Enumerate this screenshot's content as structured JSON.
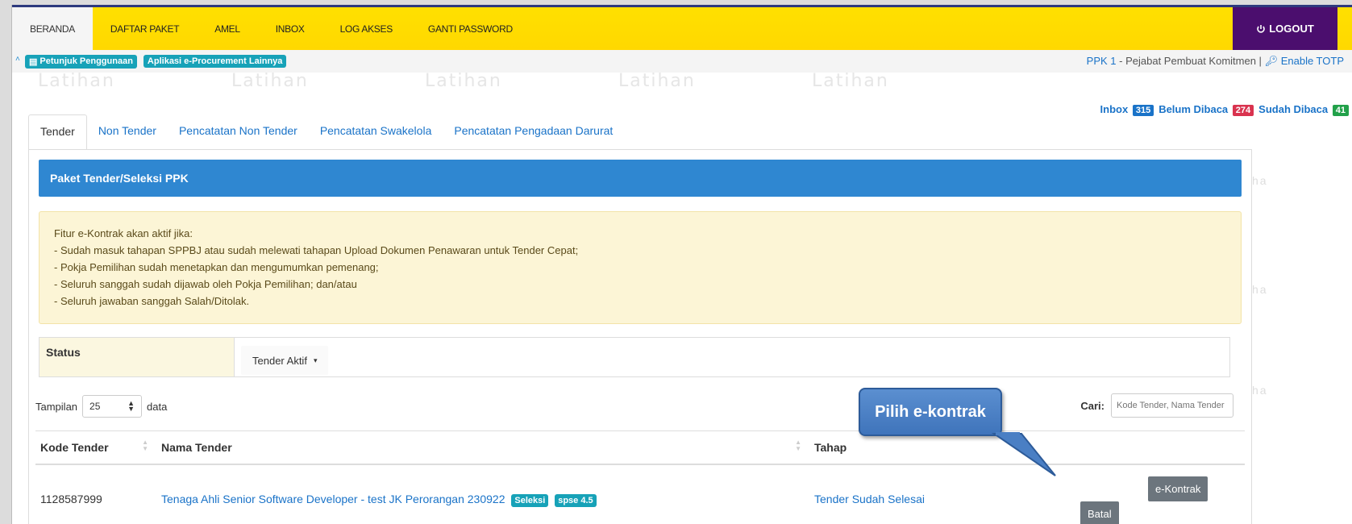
{
  "nav": {
    "items": [
      "BERANDA",
      "DAFTAR PAKET",
      "AMEL",
      "INBOX",
      "LOG AKSES",
      "GANTI PASSWORD"
    ],
    "logout": "LOGOUT"
  },
  "strip": {
    "petunjuk": "Petunjuk Penggunaan",
    "aplikasi": "Aplikasi e-Procurement Lainnya",
    "role": "PPK 1",
    "role_desc": " - Pejabat Pembuat Komitmen | ",
    "enable_totp": "Enable TOTP"
  },
  "inbox": {
    "inbox_label": "Inbox",
    "inbox_count": "315",
    "unread_label": "Belum Dibaca",
    "unread_count": "274",
    "read_label": "Sudah Dibaca",
    "read_count": "41"
  },
  "tabs": [
    "Tender",
    "Non Tender",
    "Pencatatan Non Tender",
    "Pencatatan Swakelola",
    "Pencatatan Pengadaan Darurat"
  ],
  "panel_title": "Paket Tender/Seleksi PPK",
  "notice": [
    "Fitur e-Kontrak akan aktif jika:",
    "- Sudah masuk tahapan SPPBJ atau sudah melewati tahapan Upload Dokumen Penawaran untuk Tender Cepat;",
    "- Pokja Pemilihan sudah menetapkan dan mengumumkan pemenang;",
    "- Seluruh sanggah sudah dijawab oleh Pokja Pemilihan; dan/atau",
    "- Seluruh jawaban sanggah Salah/Ditolak."
  ],
  "status": {
    "label": "Status",
    "value": "Tender Aktif"
  },
  "length": {
    "prefix": "Tampilan",
    "value": "25",
    "suffix": "data"
  },
  "search": {
    "label": "Cari:",
    "placeholder": "Kode Tender, Nama Tender"
  },
  "table": {
    "headers": [
      "Kode Tender",
      "Nama Tender",
      "Tahap"
    ],
    "rows": [
      {
        "kode": "1128587999",
        "nama": "Tenaga Ahli Senior Software Developer - test JK Perorangan 230922",
        "label1": "Seleksi",
        "label2": "spse 4.5",
        "tahap": "Tender Sudah Selesai",
        "btn1": "e-Kontrak",
        "btn2": "Batal"
      }
    ]
  },
  "callout": "Pilih e-kontrak",
  "watermark": "Latihan",
  "watermark_right": "ha"
}
